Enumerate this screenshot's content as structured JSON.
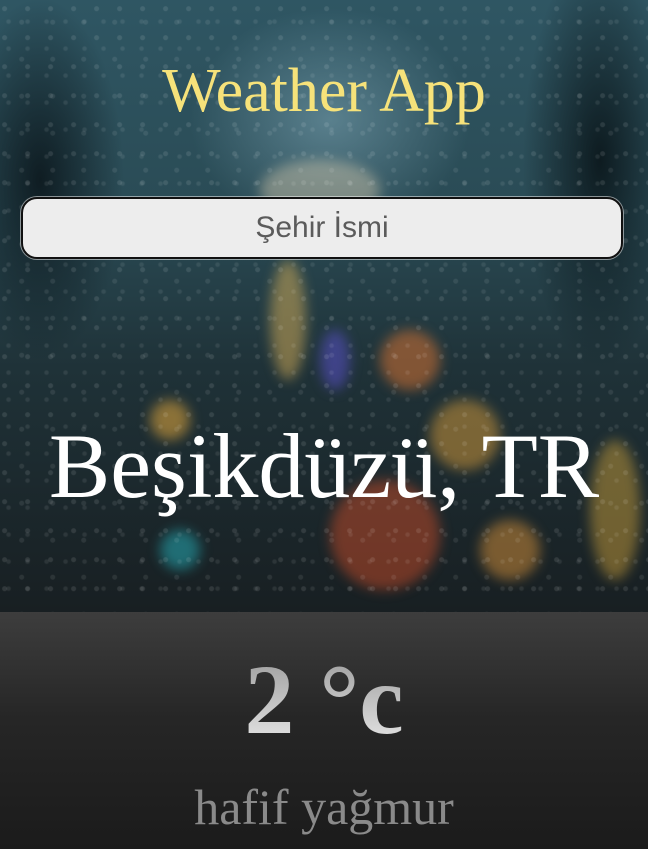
{
  "app": {
    "title": "Weather App"
  },
  "search": {
    "placeholder": "Şehir İsmi",
    "value": ""
  },
  "location": {
    "name": "Beşikdüzü, TR"
  },
  "weather": {
    "temperature": "2 °c",
    "description": "hafif yağmur"
  },
  "colors": {
    "title": "#f6e27a",
    "city": "#ffffff",
    "temperature": "#c8c8c8",
    "description": "#8a8a8a"
  }
}
